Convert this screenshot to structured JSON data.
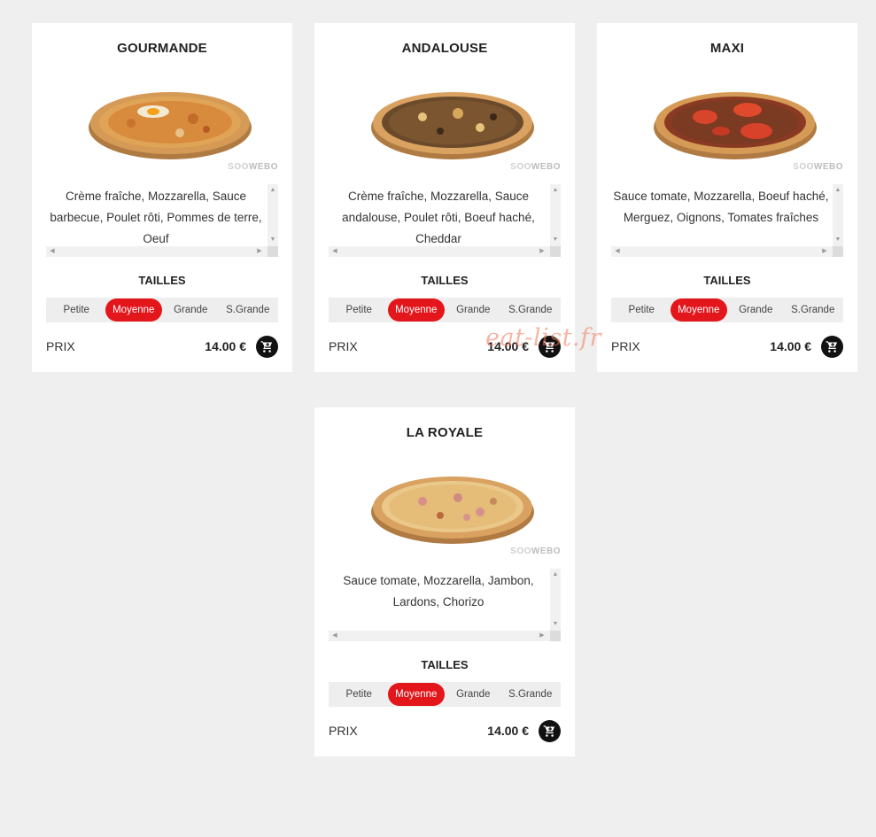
{
  "labels": {
    "sizes": "TAILLES",
    "price": "PRIX"
  },
  "brand": {
    "watermark_prefix": "SOO",
    "watermark_main": "WEBO",
    "site_watermark": "eat-list.fr"
  },
  "colors": {
    "accent": "#e3161b",
    "page_bg": "#efefef",
    "card_bg": "#ffffff",
    "cart_bg": "#111111"
  },
  "icons": {
    "cart": "shopping-cart-icon",
    "scroll_up": "caret-up",
    "scroll_down": "caret-down",
    "scroll_left": "caret-left",
    "scroll_right": "caret-right"
  },
  "size_options": [
    "Petite",
    "Moyenne",
    "Grande",
    "S.Grande"
  ],
  "products": [
    {
      "name": "GOURMANDE",
      "description": "Crème fraîche, Mozzarella, Sauce barbecue, Poulet rôti, Pommes de terre, Oeuf",
      "selected_size": "Moyenne",
      "price": "14.00 €"
    },
    {
      "name": "ANDALOUSE",
      "description": "Crème fraîche, Mozzarella, Sauce andalouse, Poulet rôti, Boeuf haché, Cheddar",
      "selected_size": "Moyenne",
      "price": "14.00 €"
    },
    {
      "name": "MAXI",
      "description": "Sauce tomate, Mozzarella, Boeuf haché, Merguez, Oignons, Tomates fraîches",
      "selected_size": "Moyenne",
      "price": "14.00 €"
    },
    {
      "name": "LA ROYALE",
      "description": "Sauce tomate, Mozzarella, Jambon, Lardons, Chorizo",
      "selected_size": "Moyenne",
      "price": "14.00 €"
    }
  ]
}
